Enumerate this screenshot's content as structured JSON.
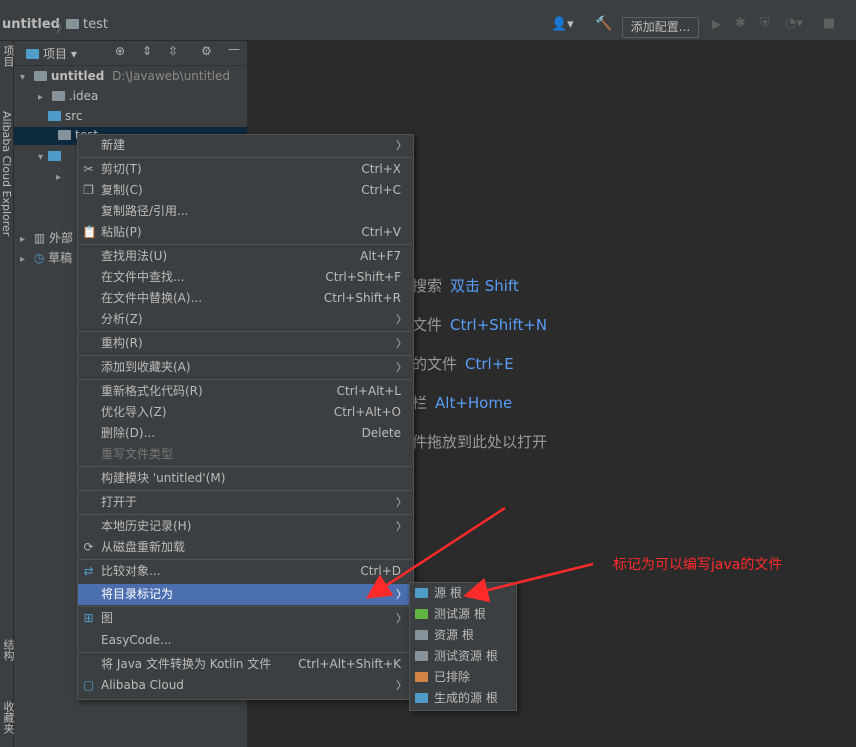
{
  "navbar": {
    "project": "untitled",
    "folder": "test",
    "run_config": "添加配置..."
  },
  "left_strip": {
    "project_tab": "项目",
    "cloud_tab": "Alibaba Cloud Explorer",
    "structure_tab": "结构",
    "favorites_tab": "收藏夹"
  },
  "project_panel": {
    "title": "项目",
    "root": {
      "name": "untitled",
      "path": "D:\\Javaweb\\untitled"
    },
    "items": [
      ".idea",
      "src",
      "test"
    ],
    "external_libs": "外部",
    "scratches": "草稿"
  },
  "editor_hints": [
    {
      "text": "搜索",
      "key": "双击 Shift"
    },
    {
      "text": "文件",
      "key": "Ctrl+Shift+N"
    },
    {
      "text": "的文件",
      "key": "Ctrl+E"
    },
    {
      "text": "栏",
      "key": "Alt+Home"
    },
    {
      "text": "件拖放到此处以打开",
      "key": ""
    }
  ],
  "context_menu": {
    "items": [
      {
        "label": "新建",
        "shortcut": "",
        "submenu": true
      },
      {
        "label": "剪切(T)",
        "shortcut": "Ctrl+X",
        "icon": "scissors-icon"
      },
      {
        "label": "复制(C)",
        "shortcut": "Ctrl+C",
        "icon": "copy-icon"
      },
      {
        "label": "复制路径/引用...",
        "shortcut": ""
      },
      {
        "label": "粘贴(P)",
        "shortcut": "Ctrl+V",
        "icon": "paste-icon"
      },
      {
        "label": "查找用法(U)",
        "shortcut": "Alt+F7"
      },
      {
        "label": "在文件中查找...",
        "shortcut": "Ctrl+Shift+F"
      },
      {
        "label": "在文件中替换(A)...",
        "shortcut": "Ctrl+Shift+R"
      },
      {
        "label": "分析(Z)",
        "shortcut": "",
        "submenu": true
      },
      {
        "label": "重构(R)",
        "shortcut": "",
        "submenu": true
      },
      {
        "label": "添加到收藏夹(A)",
        "shortcut": "",
        "submenu": true
      },
      {
        "label": "重新格式化代码(R)",
        "shortcut": "Ctrl+Alt+L"
      },
      {
        "label": "优化导入(Z)",
        "shortcut": "Ctrl+Alt+O"
      },
      {
        "label": "删除(D)...",
        "shortcut": "Delete"
      },
      {
        "label": "重写文件类型",
        "shortcut": "",
        "disabled": true
      },
      {
        "label": "构建模块 'untitled'(M)",
        "shortcut": ""
      },
      {
        "label": "打开于",
        "shortcut": "",
        "submenu": true
      },
      {
        "label": "本地历史记录(H)",
        "shortcut": "",
        "submenu": true
      },
      {
        "label": "从磁盘重新加载",
        "shortcut": "",
        "icon": "reload-icon"
      },
      {
        "label": "比较对象...",
        "shortcut": "Ctrl+D",
        "icon": "compare-icon"
      },
      {
        "label": "将目录标记为",
        "shortcut": "",
        "submenu": true,
        "selected": true
      },
      {
        "label": "图",
        "shortcut": "",
        "submenu": true,
        "icon": "diagram-icon"
      },
      {
        "label": "EasyCode...",
        "shortcut": ""
      },
      {
        "label": "将 Java 文件转换为 Kotlin 文件",
        "shortcut": "Ctrl+Alt+Shift+K"
      },
      {
        "label": "Alibaba Cloud",
        "shortcut": "",
        "submenu": true,
        "icon": "alibaba-cloud-icon"
      }
    ]
  },
  "submenu": {
    "items": [
      {
        "label": "源 根",
        "color": "#4f9cc9"
      },
      {
        "label": "测试源 根",
        "color": "#62b543"
      },
      {
        "label": "资源 根",
        "color": "#87939a"
      },
      {
        "label": "测试资源 根",
        "color": "#87939a"
      },
      {
        "label": "已排除",
        "color": "#d28445"
      },
      {
        "label": "生成的源 根",
        "color": "#4f9cc9"
      }
    ]
  },
  "annotation": {
    "text": "标记为可以编写java的文件",
    "color": "#ff2a2a"
  }
}
